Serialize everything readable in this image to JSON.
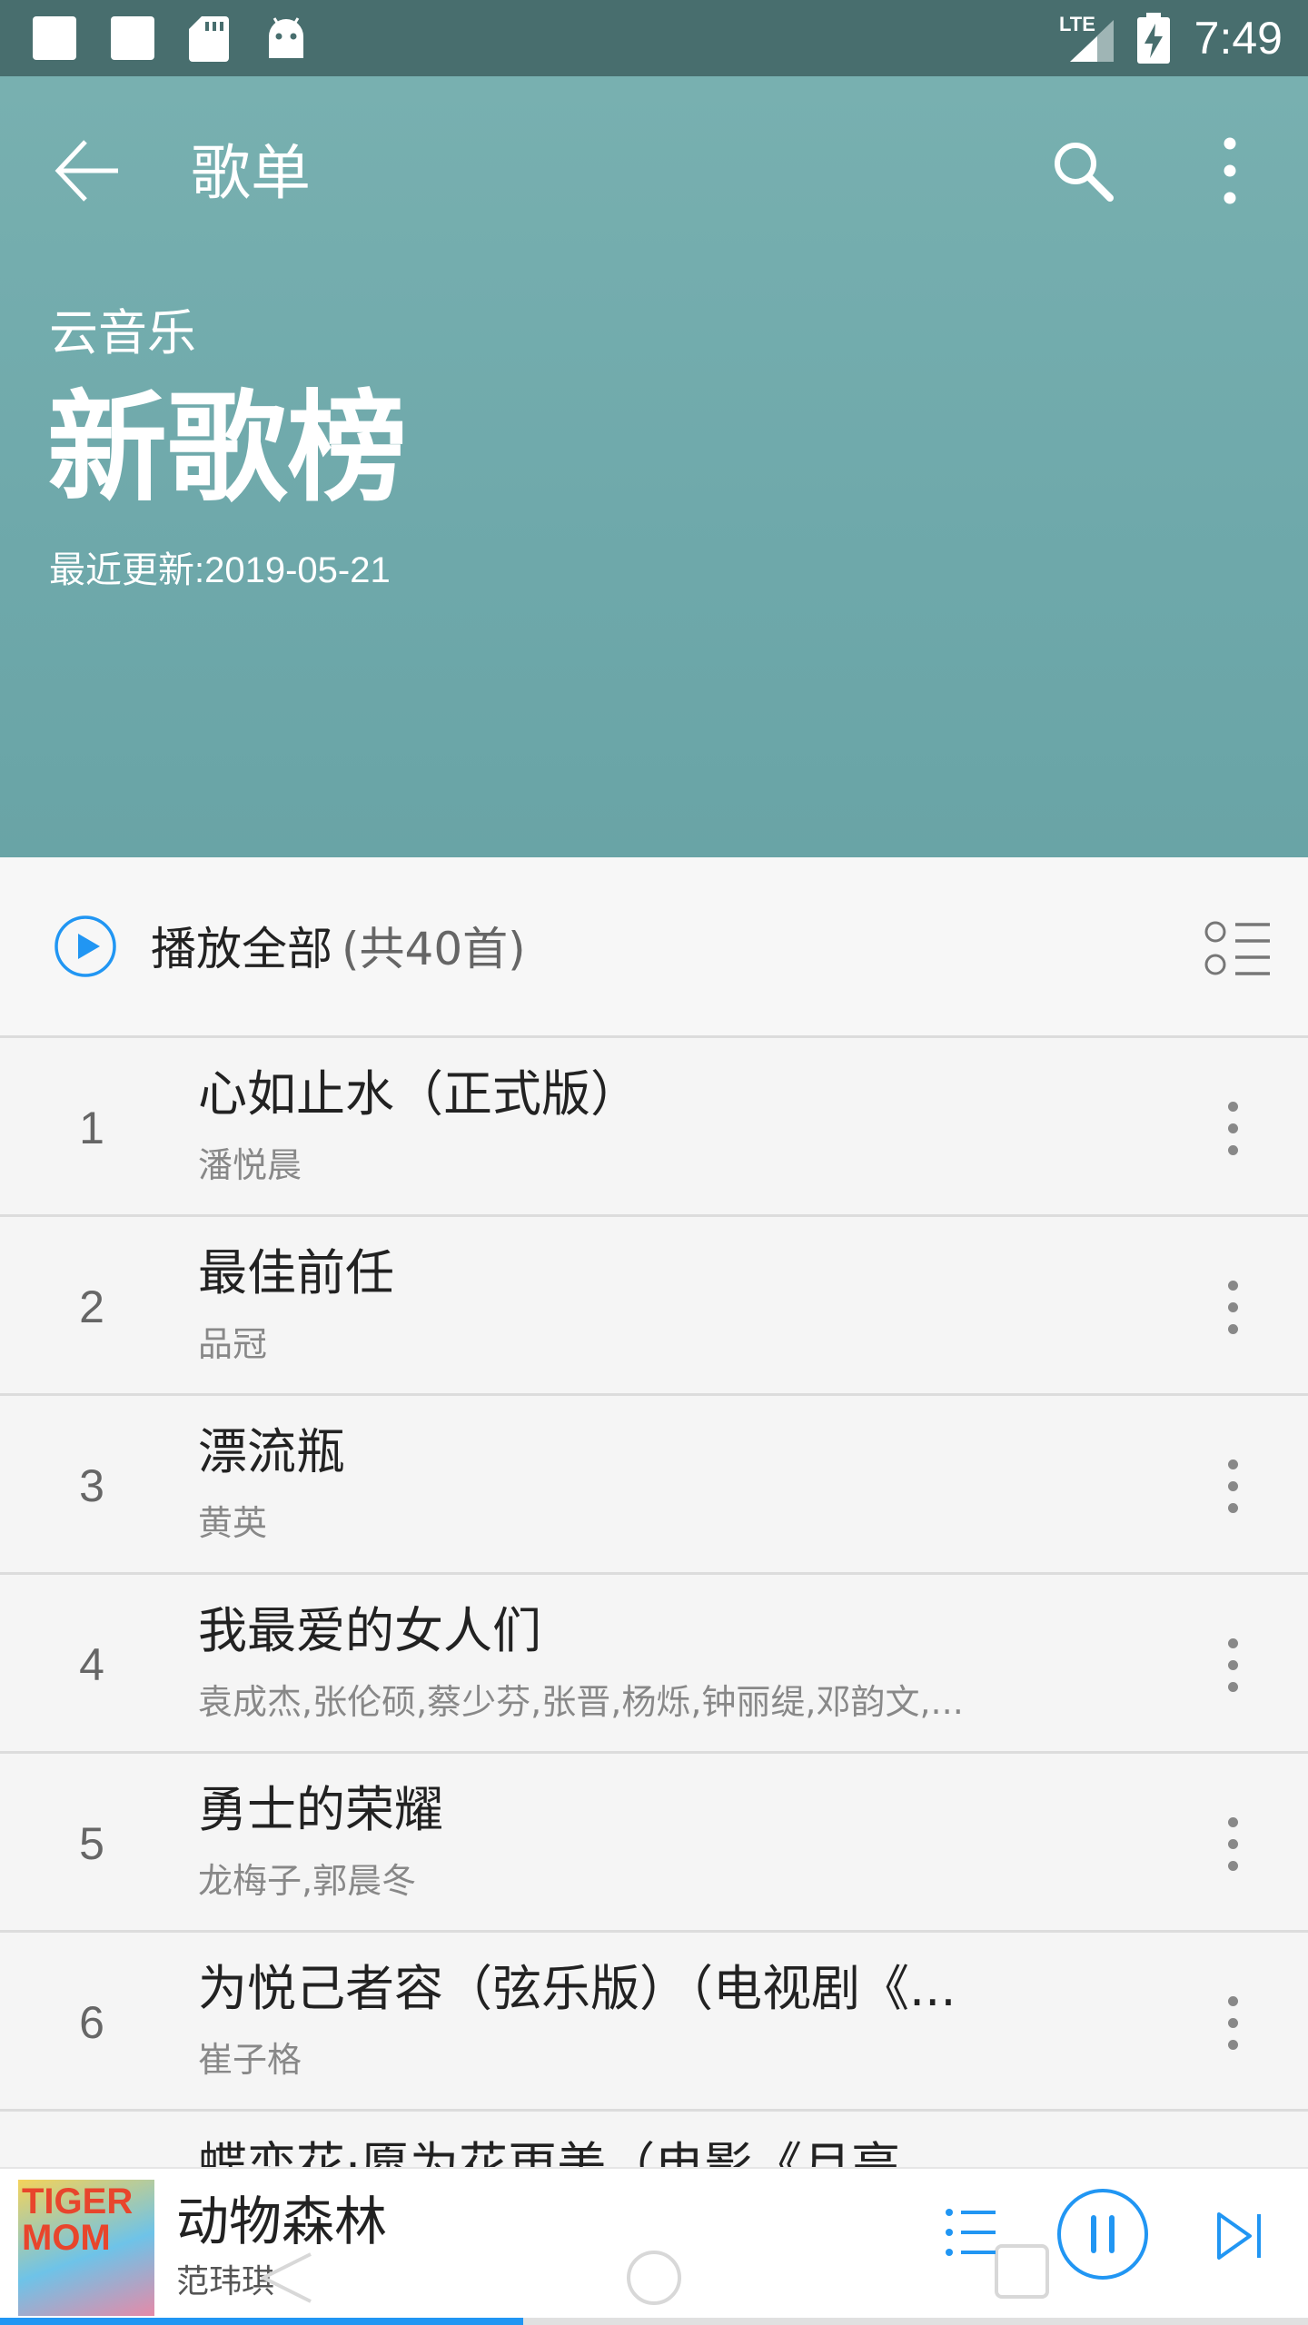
{
  "status_bar": {
    "time": "7:49",
    "network": "LTE"
  },
  "toolbar": {
    "title": "歌单"
  },
  "header": {
    "source": "云音乐",
    "title": "新歌榜",
    "updated": "最近更新:2019-05-21"
  },
  "play_all": {
    "label": "播放全部",
    "count": "(共40首)"
  },
  "songs": [
    {
      "num": "1",
      "title": "心如止水（正式版）",
      "artist": "潘悦晨"
    },
    {
      "num": "2",
      "title": "最佳前任",
      "artist": "品冠"
    },
    {
      "num": "3",
      "title": "漂流瓶",
      "artist": "黄英"
    },
    {
      "num": "4",
      "title": "我最爱的女人们",
      "artist": "袁成杰,张伦硕,蔡少芬,张晋,杨烁,钟丽缇,邓韵文,..."
    },
    {
      "num": "5",
      "title": "勇士的荣耀",
      "artist": "龙梅子,郭晨冬"
    },
    {
      "num": "6",
      "title": "为悦己者容（弦乐版）（电视剧《...",
      "artist": "崔子格"
    },
    {
      "num": "",
      "title": "蝶恋花·愿为花更美（电影《月亮",
      "artist": ""
    }
  ],
  "now_playing": {
    "cover_text": "TIGER MOM",
    "title": "动物森林",
    "artist": "范玮琪",
    "progress": 0.4
  },
  "colors": {
    "header_bg": "#6fa9ab",
    "status_bg": "#486e6e",
    "accent": "#2196f3"
  }
}
